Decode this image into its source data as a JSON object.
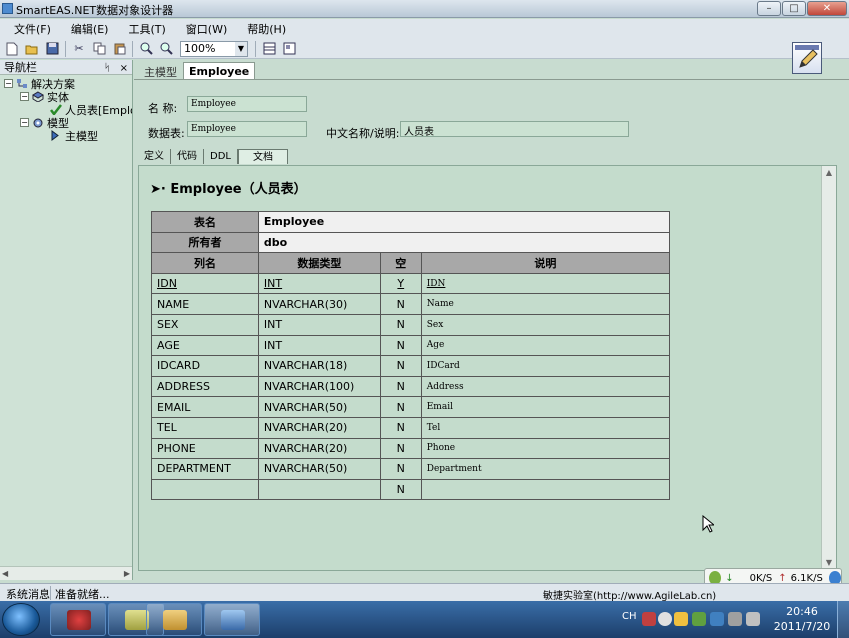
{
  "window": {
    "title": "SmartEAS.NET数据对象设计器"
  },
  "menu": [
    "文件(F)",
    "编辑(E)",
    "工具(T)",
    "窗口(W)",
    "帮助(H)"
  ],
  "toolbar": {
    "zoom": "100%"
  },
  "nav": {
    "title": "导航栏",
    "pin": "ᛋ",
    "close": "×",
    "tree": {
      "root": "解决方案",
      "entity": "实体",
      "entity_item": "人员表[Employee]",
      "model": "模型",
      "model_item": "主模型"
    }
  },
  "tabs": {
    "main_model": "主模型",
    "employee": "Employee"
  },
  "form": {
    "name_label": "名  称:",
    "name_value": "Employee",
    "table_label": "数据表:",
    "table_value": "Employee",
    "cn_label": "中文名称/说明:",
    "cn_value": "人员表"
  },
  "subtabs": [
    "定义",
    "代码",
    "DDL",
    "文档"
  ],
  "doc": {
    "heading": "Employee（人员表）",
    "table_name_label": "表名",
    "table_name_value": "Employee",
    "owner_label": "所有者",
    "owner_value": "dbo",
    "columns": [
      "列名",
      "数据类型",
      "空",
      "说明"
    ],
    "rows": [
      [
        "IDN",
        "INT",
        "Y",
        "IDN"
      ],
      [
        "NAME",
        "NVARCHAR(30)",
        "N",
        "Name"
      ],
      [
        "SEX",
        "INT",
        "N",
        "Sex"
      ],
      [
        "AGE",
        "INT",
        "N",
        "Age"
      ],
      [
        "IDCARD",
        "NVARCHAR(18)",
        "N",
        "IDCard"
      ],
      [
        "ADDRESS",
        "NVARCHAR(100)",
        "N",
        "Address"
      ],
      [
        "EMAIL",
        "NVARCHAR(50)",
        "N",
        "Email"
      ],
      [
        "TEL",
        "NVARCHAR(20)",
        "N",
        "Tel"
      ],
      [
        "PHONE",
        "NVARCHAR(20)",
        "N",
        "Phone"
      ],
      [
        "DEPARTMENT",
        "NVARCHAR(50)",
        "N",
        "Department"
      ],
      [
        "",
        "",
        "N",
        ""
      ]
    ]
  },
  "status": {
    "left": "系统消息",
    "message": "准备就绪...",
    "right": "敏捷实验室(http://www.AgileLab.cn)"
  },
  "netmeter": {
    "down": "0K/S",
    "up": "6.1K/S"
  },
  "tray": {
    "lang": "CH"
  },
  "clock": {
    "time": "20:46",
    "date": "2011/7/20"
  }
}
